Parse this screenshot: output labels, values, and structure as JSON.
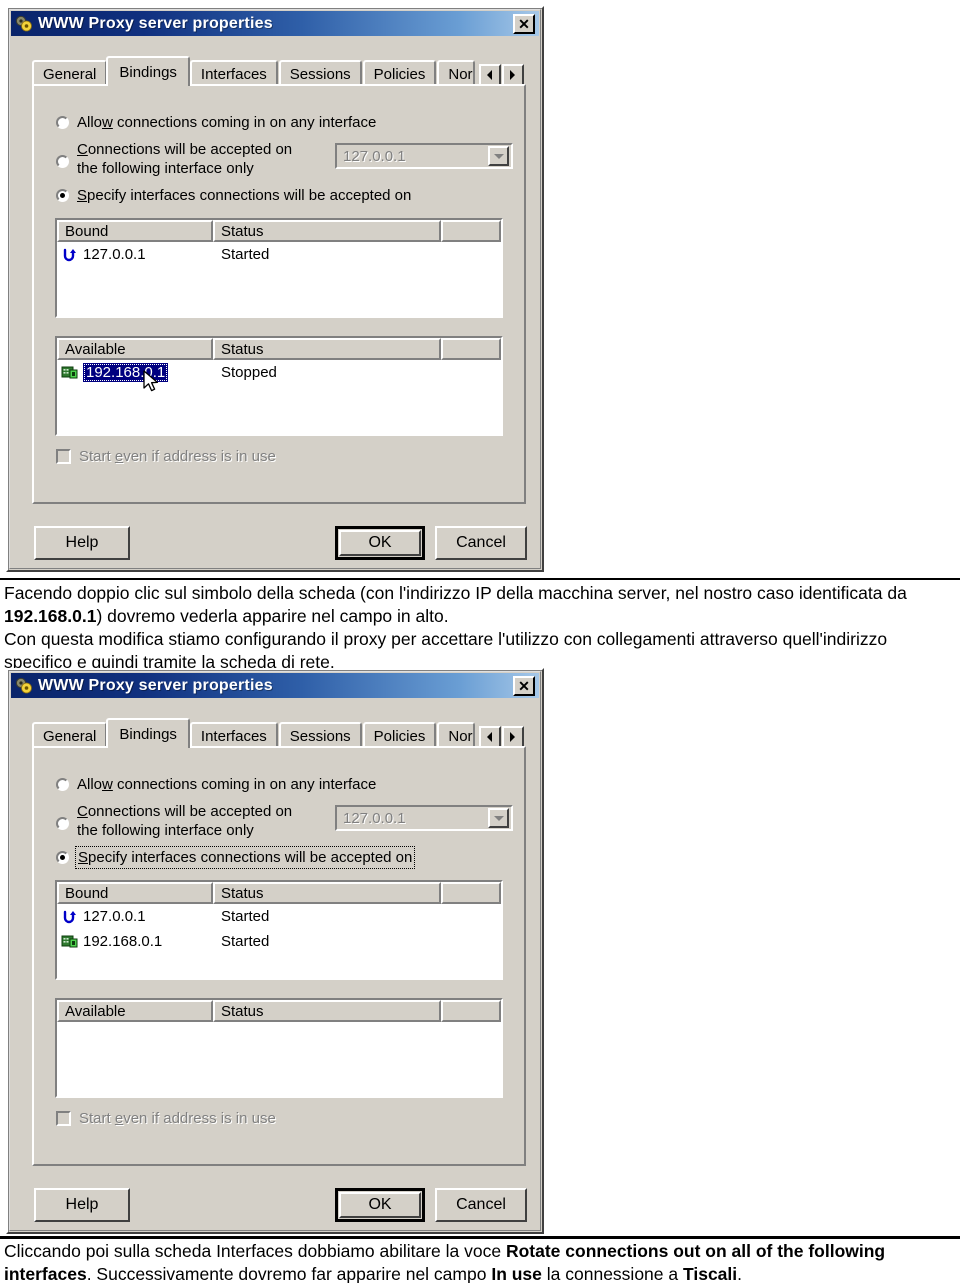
{
  "dialog": {
    "title": "WWW Proxy server properties",
    "title_icon": "gears-icon",
    "close_label": "✕",
    "tabs": [
      {
        "label": "General",
        "selected": false
      },
      {
        "label": "Bindings",
        "selected": true
      },
      {
        "label": "Interfaces",
        "selected": false
      },
      {
        "label": "Sessions",
        "selected": false
      },
      {
        "label": "Policies",
        "selected": false
      },
      {
        "label": "Nor",
        "selected": false
      }
    ],
    "tab_scroll_left": "◄",
    "tab_scroll_right": "►",
    "radios": [
      {
        "label": "Allow connections coming in on any interface",
        "accel": "w",
        "checked": false
      },
      {
        "label": "Connections will be accepted on the following interface only",
        "accel": "C",
        "checked": false
      },
      {
        "label": "Specify interfaces connections will be accepted on",
        "accel": "S",
        "checked": true
      }
    ],
    "radio2_line1": "Connections will be accepted on",
    "radio2_line2": "the following interface only",
    "interface_combo": {
      "value": "127.0.0.1",
      "enabled": false
    },
    "bound_list": {
      "columns": [
        "Bound",
        "Status",
        ""
      ],
      "rows_first": [
        {
          "icon": "loopback-icon",
          "address": "127.0.0.1",
          "status": "Started",
          "selected": false
        }
      ],
      "rows_second": [
        {
          "icon": "loopback-icon",
          "address": "127.0.0.1",
          "status": "Started",
          "selected": false
        },
        {
          "icon": "network-card-icon",
          "address": "192.168.0.1",
          "status": "Started",
          "selected": false
        }
      ]
    },
    "available_list": {
      "columns": [
        "Available",
        "Status",
        ""
      ],
      "rows_first": [
        {
          "icon": "network-card-icon",
          "address": "192.168.0.1",
          "status": "Stopped",
          "selected": true
        }
      ],
      "rows_second": []
    },
    "start_even_checkbox": {
      "label": "Start even if address is in use",
      "accel": "e",
      "checked": false,
      "enabled": false
    },
    "buttons": {
      "help": "Help",
      "ok": "OK",
      "cancel": "Cancel"
    }
  },
  "text": {
    "para1_a": "Facendo doppio clic sul simbolo della scheda (con l'indirizzo IP della macchina server, nel nostro caso identificata da ",
    "para1_b": "192.168.0.1",
    "para1_c": ") dovremo vederla apparire nel campo in alto.",
    "para2": "Con questa modifica stiamo configurando il proxy per accettare l'utilizzo con collegamenti attraverso quell'indirizzo specifico e quindi tramite la scheda di rete.",
    "para3_a": "Cliccando poi sulla scheda Interfaces dobbiamo abilitare la voce ",
    "para3_b": "Rotate connections out on all of the following interfaces",
    "para3_c": ". Successivamente dovremo far apparire nel campo ",
    "para3_d": "In use",
    "para3_e": " la connessione a ",
    "para3_f": "Tiscali",
    "para3_g": "."
  }
}
